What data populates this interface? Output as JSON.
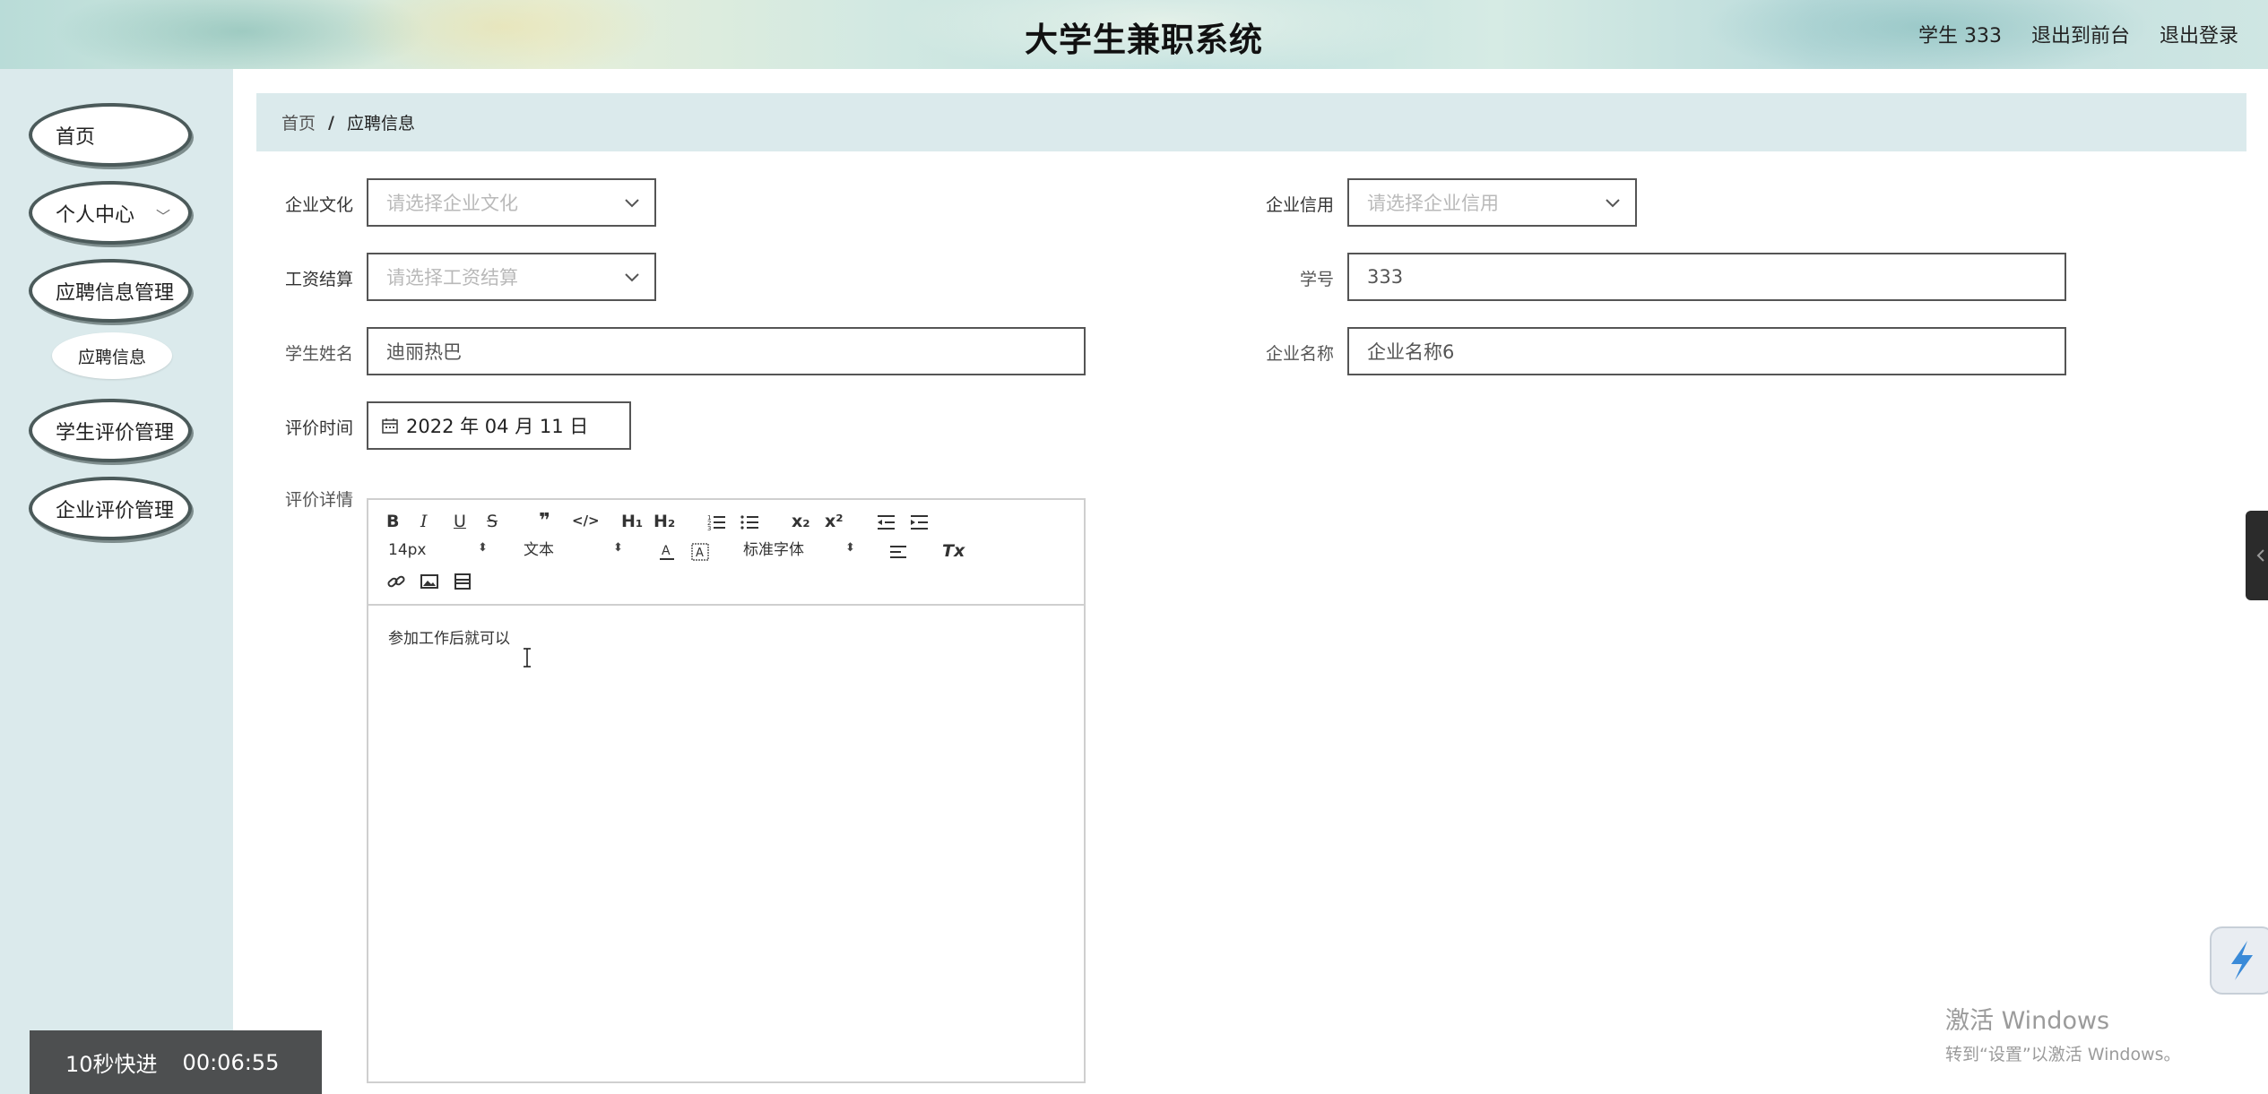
{
  "header": {
    "title": "大学生兼职系统",
    "user_label": "学生 333",
    "back_to_front": "退出到前台",
    "logout": "退出登录"
  },
  "sidebar": {
    "items": [
      {
        "label": "首页"
      },
      {
        "label": "个人中心"
      },
      {
        "label": "应聘信息管理"
      },
      {
        "label": "应聘信息"
      },
      {
        "label": "学生评价管理"
      },
      {
        "label": "企业评价管理"
      }
    ]
  },
  "breadcrumb": {
    "home": "首页",
    "separator": "/",
    "current": "应聘信息"
  },
  "form": {
    "culture": {
      "label": "企业文化",
      "placeholder": "请选择企业文化"
    },
    "credit": {
      "label": "企业信用",
      "placeholder": "请选择企业信用"
    },
    "salary": {
      "label": "工资结算",
      "placeholder": "请选择工资结算"
    },
    "student_id": {
      "label": "学号",
      "value": "333"
    },
    "student_name": {
      "label": "学生姓名",
      "value": "迪丽热巴"
    },
    "company_name": {
      "label": "企业名称",
      "value": "企业名称6"
    },
    "eval_time": {
      "label": "评价时间",
      "value": "2022 年 04 月 11 日"
    },
    "eval_detail": {
      "label": "评价详情",
      "content": "参加工作后就可以"
    }
  },
  "editor_toolbar": {
    "bold": "B",
    "italic": "I",
    "underline": "U",
    "strike": "S",
    "quote": "❞",
    "code": "</>",
    "h1": "H₁",
    "h2": "H₂",
    "subscript": "x₂",
    "superscript": "x²",
    "font_size": "14px",
    "text_type": "文本",
    "font_family": "标准字体",
    "clean": "Tx"
  },
  "overlay": {
    "fast_forward": "10秒快进",
    "timer": "00:06:55"
  },
  "watermark": {
    "line1": "激活 Windows",
    "line2": "转到“设置”以激活 Windows。"
  }
}
